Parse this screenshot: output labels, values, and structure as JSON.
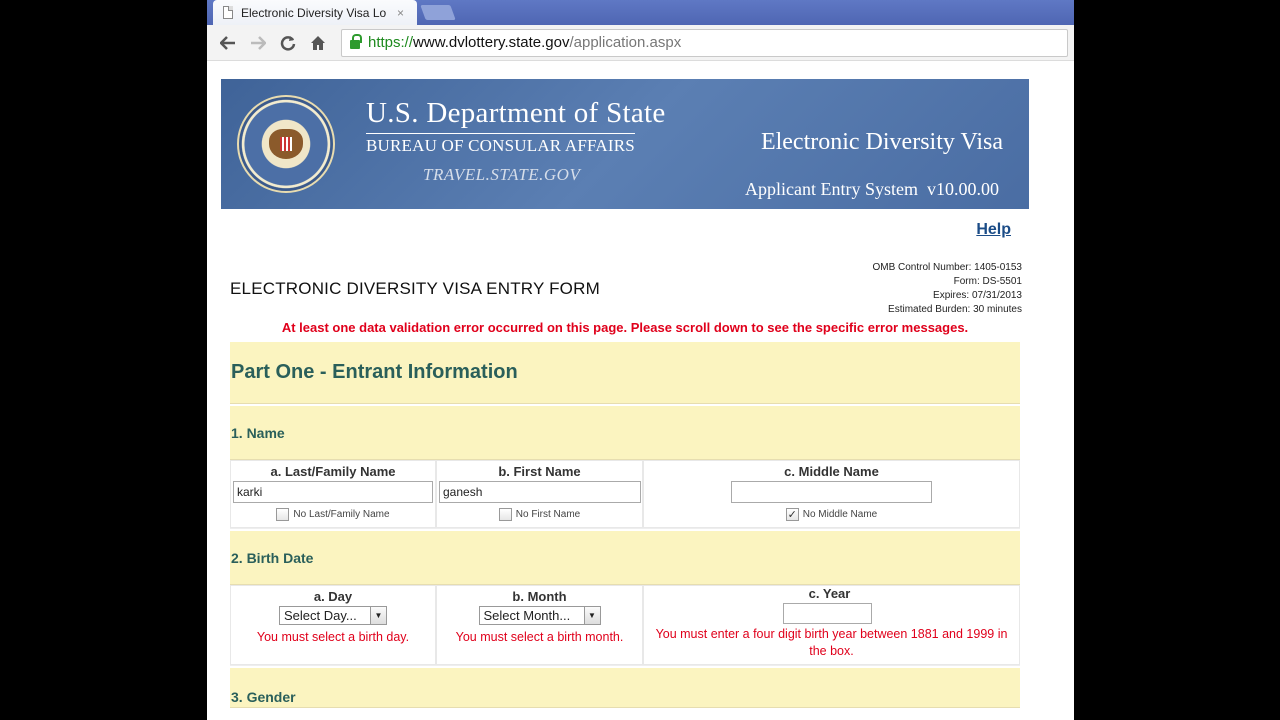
{
  "browser": {
    "tab_title": "Electronic Diversity Visa Lo",
    "tab_close": "×",
    "url_scheme": "https://",
    "url_host": "www.dvlottery.state.gov",
    "url_path": "/application.aspx"
  },
  "banner": {
    "dept": "U.S. Department of State",
    "bureau": "BUREAU OF CONSULAR AFFAIRS",
    "travel": "TRAVEL.STATE.GOV",
    "edv": "Electronic Diversity Visa",
    "system": "Applicant Entry System  v10.00.00"
  },
  "help": "Help",
  "form": {
    "title": "ELECTRONIC DIVERSITY VISA ENTRY FORM",
    "omb": [
      "OMB Control Number: 1405-0153",
      "Form: DS-5501",
      "Expires: 07/31/2013",
      "Estimated Burden: 30 minutes"
    ],
    "error": "At least one data validation error occurred on this page. Please scroll down to see the specific error messages."
  },
  "part_one": "Part One - Entrant Information",
  "name": {
    "heading": "1. Name",
    "last_label": "a. Last/Family Name",
    "last_value": "karki",
    "last_chk": "No Last/Family Name",
    "first_label": "b. First Name",
    "first_value": "ganesh",
    "first_chk": "No First Name",
    "middle_label": "c. Middle Name",
    "middle_value": "",
    "middle_chk": "No Middle Name"
  },
  "birth": {
    "heading": "2. Birth Date",
    "day_label": "a. Day",
    "day_select": "Select Day...",
    "day_err": "You must select a birth day.",
    "month_label": "b. Month",
    "month_select": "Select Month...",
    "month_err": "You must select a birth month.",
    "year_label": "c. Year",
    "year_err": "You must enter a four digit birth year between 1881 and 1999 in the box."
  },
  "gender": {
    "heading": "3. Gender"
  }
}
